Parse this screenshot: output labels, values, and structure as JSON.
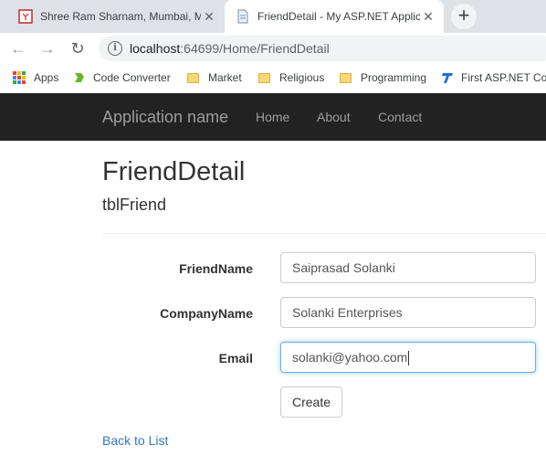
{
  "browser": {
    "tabs": [
      {
        "title": "Shree Ram Sharnam, Mumbai, M",
        "active": false
      },
      {
        "title": "FriendDetail - My ASP.NET Applic",
        "active": true
      }
    ],
    "new_tab_label": "+",
    "address": {
      "host": "localhost",
      "path": ":64699/Home/FriendDetail"
    },
    "bookmarks": [
      {
        "label": "Apps",
        "icon": "apps-grid-icon"
      },
      {
        "label": "Code Converter",
        "icon": "code-converter-icon"
      },
      {
        "label": "Market",
        "icon": "folder-icon"
      },
      {
        "label": "Religious",
        "icon": "folder-icon"
      },
      {
        "label": "Programming",
        "icon": "folder-icon"
      },
      {
        "label": "First ASP.NET Cor",
        "icon": "asp-net-icon"
      }
    ]
  },
  "site": {
    "brand": "Application name",
    "nav": [
      "Home",
      "About",
      "Contact"
    ]
  },
  "page": {
    "title": "FriendDetail",
    "subtitle": "tblFriend",
    "form": {
      "fields": [
        {
          "label": "FriendName",
          "value": "Saiprasad Solanki"
        },
        {
          "label": "CompanyName",
          "value": "Solanki Enterprises"
        },
        {
          "label": "Email",
          "value": "solanki@yahoo.com"
        }
      ],
      "submit_label": "Create"
    },
    "back_link": "Back to List"
  },
  "colors": {
    "navbar_bg": "#222222",
    "link": "#337ab7",
    "focus_border": "#66afe9"
  }
}
